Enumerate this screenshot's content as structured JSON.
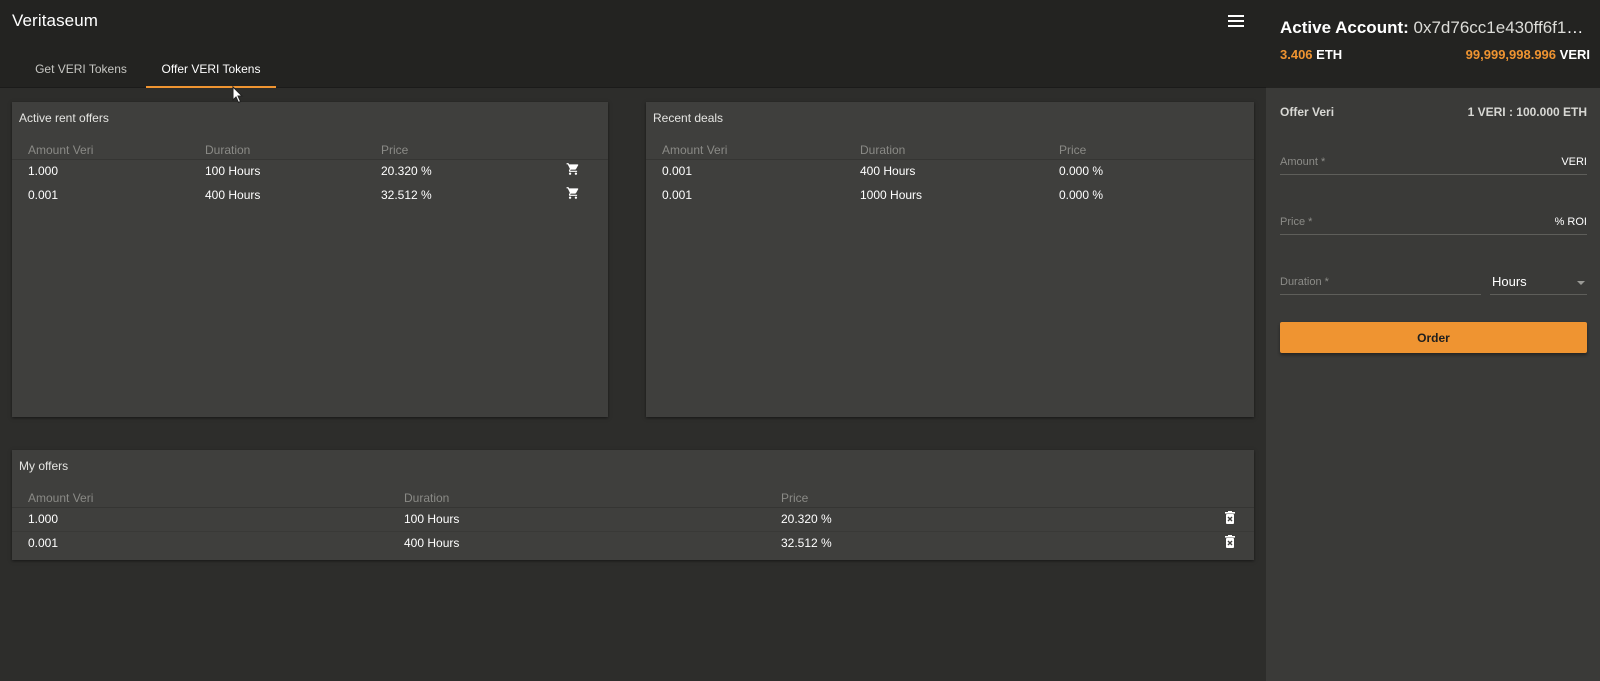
{
  "header": {
    "app_title": "Veritaseum",
    "tabs": [
      {
        "label": "Get VERI Tokens",
        "active": false
      },
      {
        "label": "Offer VERI Tokens",
        "active": true
      }
    ]
  },
  "active_rent_offers": {
    "title": "Active rent offers",
    "columns": [
      "Amount Veri",
      "Duration",
      "Price"
    ],
    "rows": [
      {
        "amount": "1.000",
        "duration": "100 Hours",
        "price": "20.320 %",
        "action_icon": "cart-icon"
      },
      {
        "amount": "0.001",
        "duration": "400 Hours",
        "price": "32.512 %",
        "action_icon": "cart-icon"
      }
    ]
  },
  "recent_deals": {
    "title": "Recent deals",
    "columns": [
      "Amount Veri",
      "Duration",
      "Price"
    ],
    "rows": [
      {
        "amount": "0.001",
        "duration": "400 Hours",
        "price": "0.000 %"
      },
      {
        "amount": "0.001",
        "duration": "1000 Hours",
        "price": "0.000 %"
      }
    ]
  },
  "my_offers": {
    "title": "My offers",
    "columns": [
      "Amount Veri",
      "Duration",
      "Price"
    ],
    "rows": [
      {
        "amount": "1.000",
        "duration": "100 Hours",
        "price": "20.320 %",
        "action_icon": "delete-icon"
      },
      {
        "amount": "0.001",
        "duration": "400 Hours",
        "price": "32.512 %",
        "action_icon": "delete-icon"
      }
    ]
  },
  "account": {
    "label": "Active Account:",
    "address": "0x7d76cc1e430ff6f16d...",
    "eth_balance": "3.406",
    "eth_unit": "ETH",
    "veri_balance": "99,999,998.996",
    "veri_unit": "VERI"
  },
  "offer_form": {
    "title": "Offer Veri",
    "rate": "1 VERI : 100.000 ETH",
    "amount_label": "Amount *",
    "amount_suffix": "VERI",
    "amount_value": "",
    "price_label": "Price *",
    "price_suffix": "% ROI",
    "price_value": "",
    "duration_label": "Duration *",
    "duration_value": "",
    "duration_unit": "Hours",
    "order_button": "Order"
  },
  "colors": {
    "accent": "#ef9431",
    "panel": "#3f3f3d",
    "background": "#2d2d2b",
    "topbar": "#232321"
  }
}
